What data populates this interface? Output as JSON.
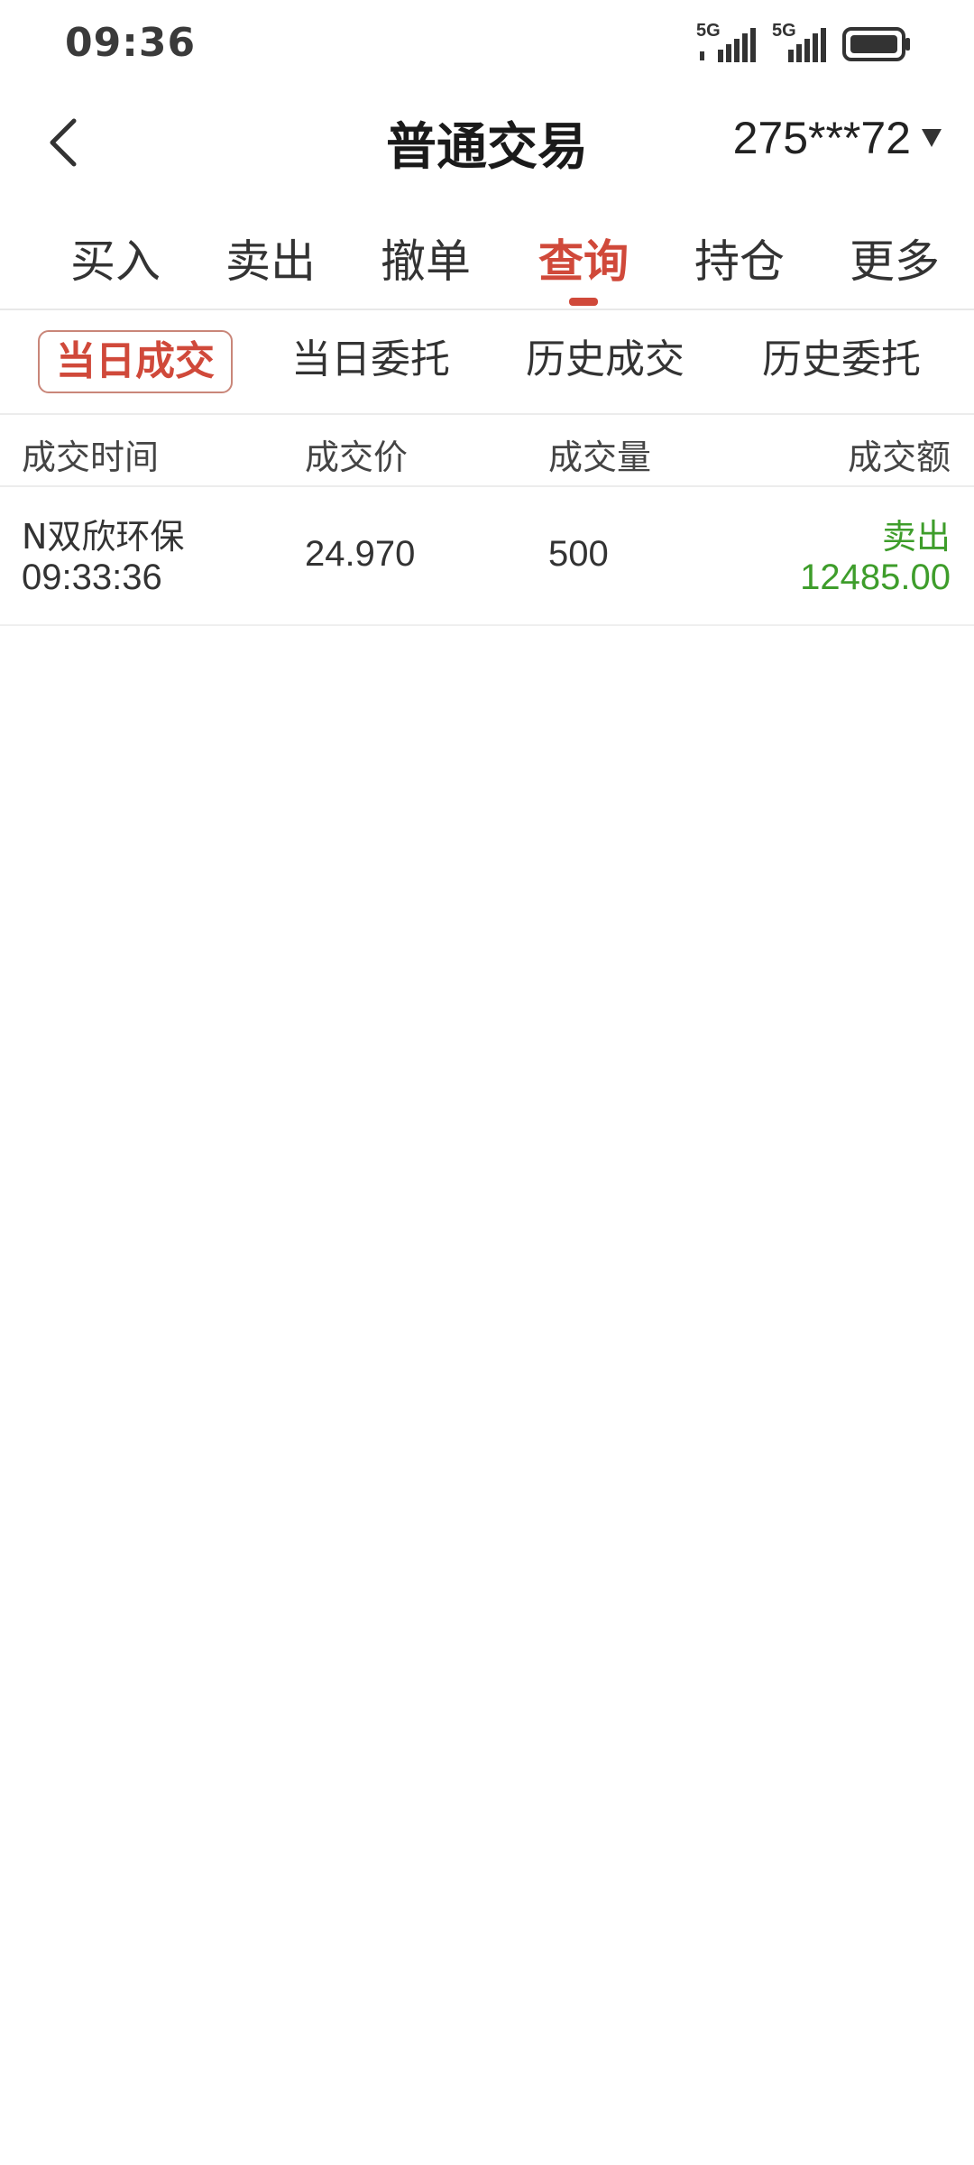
{
  "status_bar": {
    "time": "09:36",
    "signal1_label": "5G",
    "signal2_label": "5G"
  },
  "header": {
    "title": "普通交易",
    "account": "275***72"
  },
  "main_tabs": [
    {
      "label": "买入"
    },
    {
      "label": "卖出"
    },
    {
      "label": "撤单"
    },
    {
      "label": "查询"
    },
    {
      "label": "持仓"
    },
    {
      "label": "更多"
    }
  ],
  "active_main_tab": "查询",
  "sub_tabs": [
    {
      "label": "当日成交"
    },
    {
      "label": "当日委托"
    },
    {
      "label": "历史成交"
    },
    {
      "label": "历史委托"
    }
  ],
  "active_sub_tab": "当日成交",
  "table": {
    "columns": [
      "成交时间",
      "成交价",
      "成交量",
      "成交额"
    ],
    "rows": [
      {
        "name": "N双欣环保",
        "time": "09:33:36",
        "price": "24.970",
        "volume": "500",
        "direction": "卖出",
        "amount": "12485.00"
      }
    ]
  },
  "colors": {
    "accent": "#d0493a",
    "sell_green": "#3e9d2b"
  },
  "icons": {
    "back": "chevron-left-icon",
    "account_caret": "caret-down-icon",
    "battery": "battery-icon",
    "signal": "signal-bars-icon"
  }
}
